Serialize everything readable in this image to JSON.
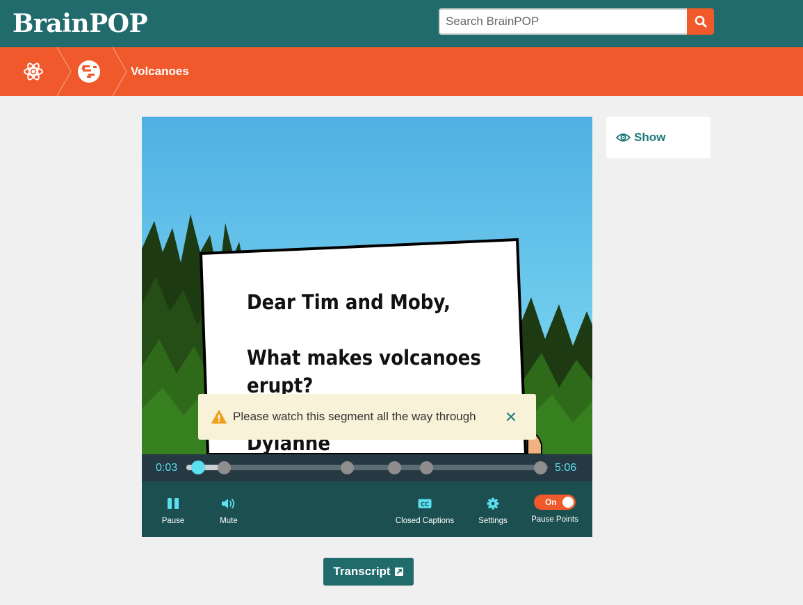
{
  "header": {
    "logo": "BrainPOP",
    "search_placeholder": "Search BrainPOP"
  },
  "breadcrumb": {
    "items": [
      {
        "icon": "atom-icon"
      },
      {
        "icon": "earth-icon"
      }
    ],
    "title": "Volcanoes"
  },
  "video": {
    "letter": {
      "salutation": "Dear Tim and Moby,",
      "question_line1": "What makes volcanoes",
      "question_line2": "erupt?",
      "signature": "Dylanne"
    },
    "progress": 0.01,
    "pause_point_fractions": [
      0.105,
      0.445,
      0.575,
      0.665,
      0.98
    ]
  },
  "player": {
    "current_time": "0:03",
    "duration": "5:06",
    "controls": {
      "pause_label": "Pause",
      "mute_label": "Mute",
      "cc_label": "Closed Captions",
      "settings_label": "Settings",
      "pause_points_label": "Pause Points",
      "pause_points_state": "On"
    }
  },
  "toast": {
    "message": "Please watch this segment all the way through"
  },
  "side_panel": {
    "show_label": "Show"
  },
  "transcript": {
    "label": "Transcript"
  },
  "colors": {
    "header": "#226b6c",
    "accent": "#ef592c",
    "scrub_accent": "#5ae0f0",
    "controls_bg": "#1c4f50"
  }
}
